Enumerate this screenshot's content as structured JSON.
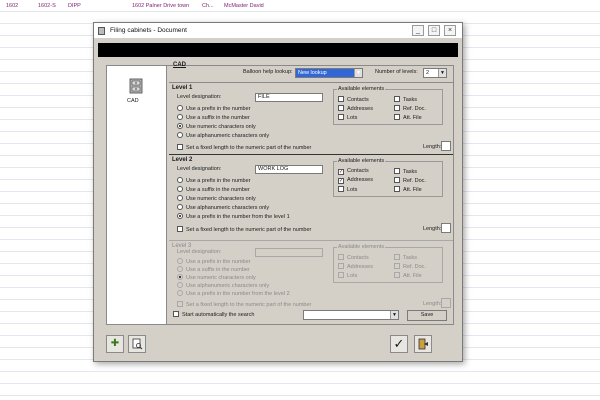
{
  "spreadsheet_row": {
    "cells": [
      "1602",
      "1602-S",
      "DIPP",
      "1602  Palner Drive town",
      "Ch...",
      "McMaster David"
    ]
  },
  "dialog": {
    "title": "Filing cabinets - Document",
    "window_buttons": [
      "_",
      "□",
      "×"
    ],
    "left_panel": {
      "icon": "filing-cabinet-icon",
      "label": "CAD"
    },
    "tab_label": "CAD",
    "balloon": {
      "label": "Balloon help lookup:",
      "value": "New lookup"
    },
    "levels_count": {
      "label": "Number of levels:",
      "value": "2"
    },
    "levels": [
      {
        "title": "Level 1",
        "designation_label": "Level designation:",
        "designation_value": "FILE",
        "options": [
          {
            "label": "Use a prefix in the number",
            "selected": false
          },
          {
            "label": "Use a suffix in the number",
            "selected": false
          },
          {
            "label": "Use numeric characters only",
            "selected": true
          },
          {
            "label": "Use alphanumeric characters only",
            "selected": false
          }
        ],
        "fixed_length_label": "Set a fixed length to the numeric part of the number",
        "length_label": "Length:",
        "available": {
          "title": "Available elements",
          "items": [
            {
              "label": "Contacts",
              "checked": false
            },
            {
              "label": "Tasks",
              "checked": false
            },
            {
              "label": "Addresses",
              "checked": false
            },
            {
              "label": "Ref. Doc.",
              "checked": false
            },
            {
              "label": "Lots",
              "checked": false
            },
            {
              "label": "Att. File",
              "checked": false
            }
          ]
        }
      },
      {
        "title": "Level 2",
        "designation_label": "Level designation:",
        "designation_value": "WORK LOG",
        "options": [
          {
            "label": "Use a prefix in the number",
            "selected": false
          },
          {
            "label": "Use a suffix in the number",
            "selected": false
          },
          {
            "label": "Use numeric characters only",
            "selected": false
          },
          {
            "label": "Use alphanumeric characters only",
            "selected": false
          },
          {
            "label": "Use a prefix in the number from the level 1",
            "selected": true
          }
        ],
        "fixed_length_label": "Set a fixed length to the numeric part of the number",
        "length_label": "Length:",
        "available": {
          "title": "Available elements",
          "items": [
            {
              "label": "Contacts",
              "checked": true
            },
            {
              "label": "Tasks",
              "checked": false
            },
            {
              "label": "Addresses",
              "checked": true
            },
            {
              "label": "Ref. Doc.",
              "checked": false
            },
            {
              "label": "Lots",
              "checked": false
            },
            {
              "label": "Att. File",
              "checked": false
            }
          ]
        }
      },
      {
        "title": "Level 3",
        "designation_label": "Level designation:",
        "designation_value": "",
        "options": [
          {
            "label": "Use a prefix in the number",
            "selected": false
          },
          {
            "label": "Use a suffix in the number",
            "selected": false
          },
          {
            "label": "Use numeric characters only",
            "selected": true
          },
          {
            "label": "Use alphanumeric characters only",
            "selected": false
          },
          {
            "label": "Use a prefix in the number from the level 2",
            "selected": false
          }
        ],
        "fixed_length_label": "Set a fixed length to the numeric part of the number",
        "length_label": "Length:",
        "available": {
          "title": "Available elements",
          "items": [
            {
              "label": "Contacts",
              "checked": false
            },
            {
              "label": "Tasks",
              "checked": false
            },
            {
              "label": "Addresses",
              "checked": false
            },
            {
              "label": "Ref. Doc.",
              "checked": false
            },
            {
              "label": "Lots",
              "checked": false
            },
            {
              "label": "Att. File",
              "checked": false
            }
          ]
        }
      }
    ],
    "auto_search_label": "Start automatically the search",
    "save_label": "Save",
    "footer_buttons": {
      "add": "plus-icon",
      "preview": "document-preview-icon",
      "ok": "checkmark-icon",
      "exit": "exit-door-icon"
    }
  }
}
